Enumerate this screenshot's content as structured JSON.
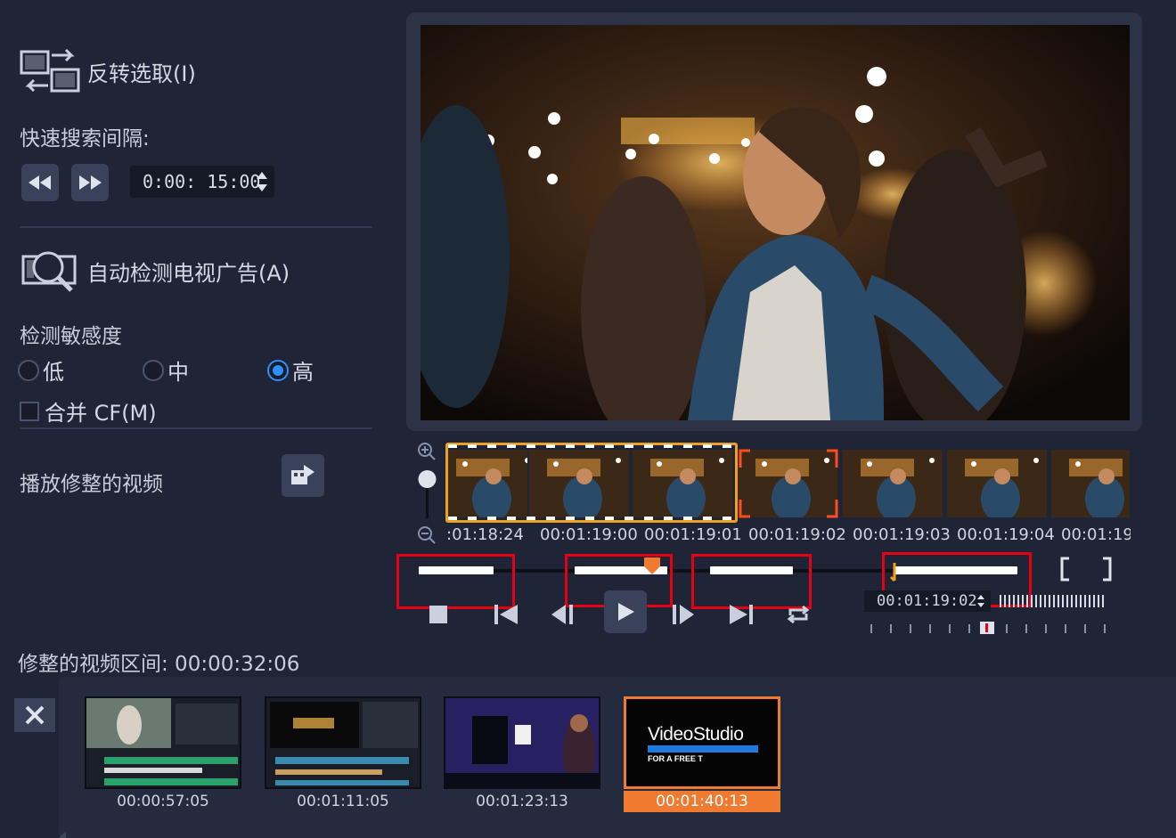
{
  "left": {
    "reverse_label": "反转选取(I)",
    "quick_search_label": "快速搜索间隔:",
    "interval_value": "0:00: 15:00",
    "auto_detect_label": "自动检测电视广告(A)",
    "sensitivity_label": "检测敏感度",
    "options": [
      {
        "label": "低",
        "selected": false
      },
      {
        "label": "中",
        "selected": false
      },
      {
        "label": "高",
        "selected": true
      }
    ],
    "merge_cf_label": "合并 CF(M)",
    "merge_cf_checked": false,
    "play_trimmed_label": "播放修整的视频"
  },
  "filmstrip": {
    "timecodes": [
      ":01:18:24",
      "00:01:19:00",
      "00:01:19:01",
      "00:01:19:02",
      "00:01:19:03",
      "00:01:19:04",
      "00:01:19:("
    ]
  },
  "scrub": {
    "selected_segments": [
      {
        "start": 0.0,
        "end": 0.125
      },
      {
        "start": 0.26,
        "end": 0.415
      },
      {
        "start": 0.487,
        "end": 0.625
      },
      {
        "start": 0.795,
        "end": 1.0
      }
    ],
    "playhead_position": 0.39
  },
  "controls": {
    "timecode": "00:01:19:02",
    "mark_in": "[",
    "mark_out": "]"
  },
  "bottom": {
    "trimmed_duration_label": "修整的视频区间: 00:00:32:06",
    "clips": [
      {
        "duration": "00:00:57:05",
        "selected": false
      },
      {
        "duration": "00:01:11:05",
        "selected": false
      },
      {
        "duration": "00:01:23:13",
        "selected": false
      },
      {
        "duration": "00:01:40:13",
        "selected": true,
        "title": "VideoStudio",
        "subtitle": "FOR A FREE T"
      }
    ]
  },
  "colors": {
    "background": "#1f2436",
    "accent_orange": "#f07a30",
    "selection_yellow": "#f0a020",
    "highlight_red": "#e60012",
    "radio_blue": "#2e8fff"
  }
}
